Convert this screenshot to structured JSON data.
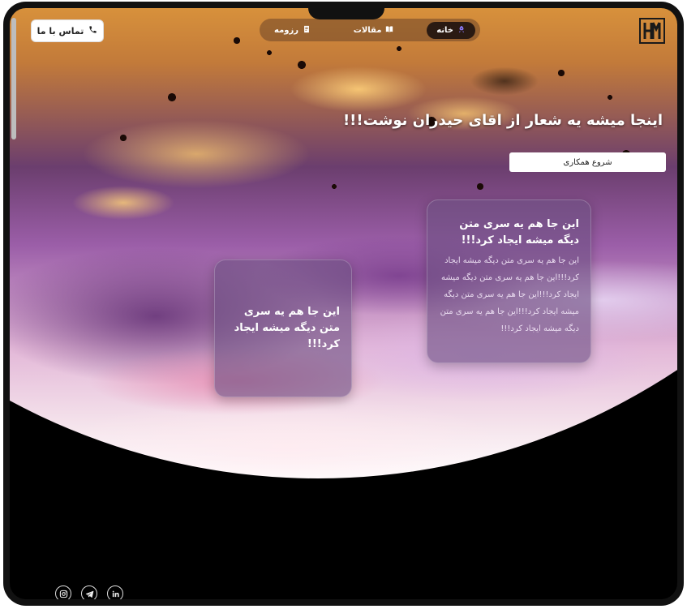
{
  "header": {
    "contact_label": "تماس با ما",
    "nav": [
      {
        "label": "خانه",
        "icon": "rocket-icon",
        "active": true
      },
      {
        "label": "مقالات",
        "icon": "book-icon",
        "active": false
      },
      {
        "label": "رزومه",
        "icon": "document-icon",
        "active": false
      }
    ],
    "logo_icon": "hm-monogram-logo"
  },
  "hero": {
    "headline": "اینجا میشه یه شعار از اقای حیدران نوشت!!!",
    "cta_label": "شروع همکاری"
  },
  "cards": [
    {
      "title": "این جا هم یه سری متن دیگه میشه ایجاد کرد!!!",
      "body": "این جا هم یه سری متن دیگه میشه ایجاد کرد!!!این جا هم یه سری متن دیگه میشه ایجاد کرد!!!این جا هم یه سری متن دیگه میشه ایجاد کرد!!!این جا هم یه سری متن دیگه میشه ایجاد کرد!!!"
    },
    {
      "title": "این جا هم یه سری متن دیگه میشه ایجاد کرد!!!"
    }
  ],
  "socials": [
    {
      "name": "instagram-icon"
    },
    {
      "name": "telegram-icon"
    },
    {
      "name": "linkedin-icon"
    }
  ],
  "colors": {
    "nav_bg": "#6e4628",
    "nav_active": "#2a1a12",
    "card_bg": "#6e5082",
    "page_bg": "#000000"
  }
}
